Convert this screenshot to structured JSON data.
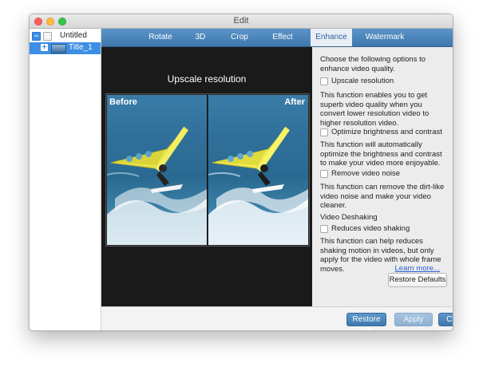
{
  "window": {
    "title": "Edit"
  },
  "sidebar": {
    "items": [
      {
        "label": "Untitled",
        "icon": "minus-square-icon"
      },
      {
        "label": "Title_1",
        "icon": "plus-icon"
      }
    ]
  },
  "tabs": [
    {
      "label": "Rotate",
      "active": false
    },
    {
      "label": "3D",
      "active": false
    },
    {
      "label": "Crop",
      "active": false
    },
    {
      "label": "Effect",
      "active": false
    },
    {
      "label": "Enhance",
      "active": true
    },
    {
      "label": "Watermark",
      "active": false
    }
  ],
  "preview": {
    "title": "Upscale resolution",
    "before_label": "Before",
    "after_label": "After"
  },
  "options": {
    "intro": "Choose the following options to enhance video quality.",
    "upscale": {
      "label": "Upscale resolution",
      "checked": false,
      "desc": "This function enables you to get superb video quality when you convert lower resolution video to higher resolution video."
    },
    "brightness": {
      "label": "Optimize brightness and contrast",
      "checked": false,
      "desc": "This function will automatically optimize the brightness and contrast to make your video more enjoyable."
    },
    "noise": {
      "label": "Remove video noise",
      "checked": false,
      "desc": "This function can remove the dirt-like video noise and make your video cleaner."
    },
    "deshake_heading": "Video Deshaking",
    "deshake": {
      "label": "Reduces video shaking",
      "checked": false,
      "desc": "This function can help reduces shaking motion in videos, but only apply for the video with whole frame moves."
    },
    "learn_more": "Learn more...",
    "restore_defaults": "Restore Defaults"
  },
  "footer": {
    "restore_all": "Restore All",
    "apply": "Apply",
    "close": "Close"
  },
  "colors": {
    "accent": "#3f78ad",
    "selection": "#3d8ee6",
    "link": "#2a5fd6"
  }
}
